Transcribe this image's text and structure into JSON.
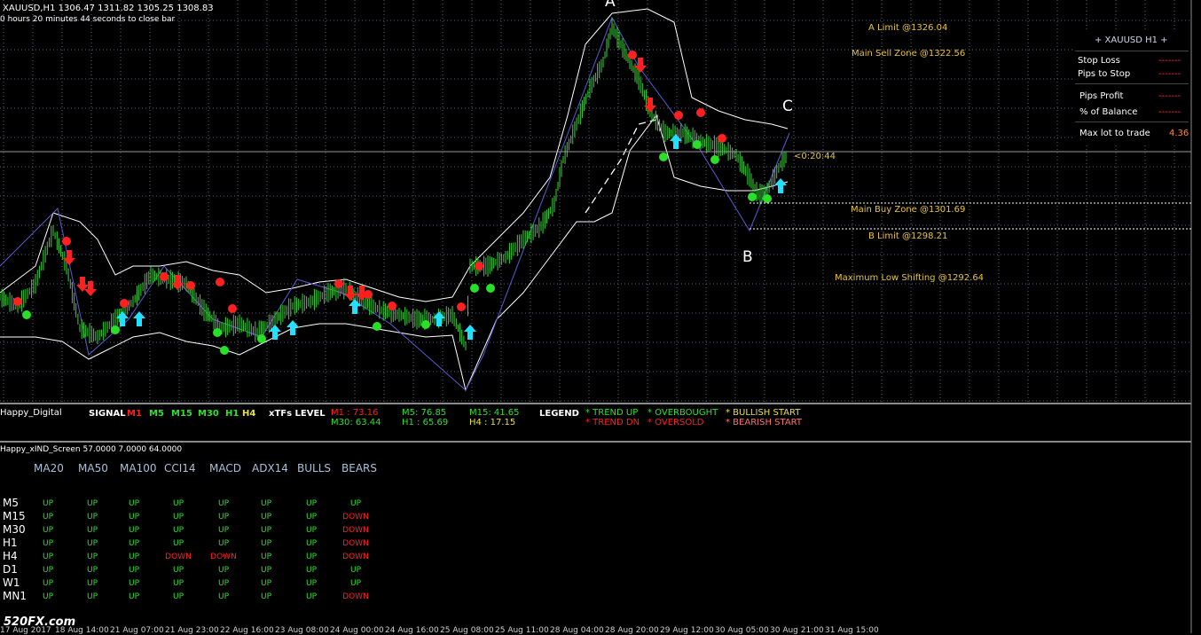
{
  "chart": {
    "symbol_line": "XAUUSD,H1  1306.47 1311.82 1305.25 1308.83",
    "timer_line": "0 hours 20 minutes 44 seconds to close bar",
    "countdown": "<0:20:44",
    "wave_labels": [
      "A",
      "B",
      "C"
    ],
    "zones": {
      "a_limit": "A Limit @1326.04",
      "main_sell": "Main Sell Zone @1322.56",
      "main_buy": "Main Buy Zone @1301.69",
      "b_limit": "B Limit @1298.21",
      "max_low": "Maximum Low Shifting @1292.64"
    },
    "time_axis": [
      "17 Aug 2017",
      "18 Aug 14:00",
      "21 Aug 07:00",
      "21 Aug 23:00",
      "22 Aug 16:00",
      "23 Aug 08:00",
      "24 Aug 00:00",
      "24 Aug 16:00",
      "25 Aug 08:00",
      "25 Aug 11:00",
      "28 Aug 04:00",
      "28 Aug 20:00",
      "29 Aug 12:00",
      "30 Aug 05:00",
      "30 Aug 21:00",
      "31 Aug 15:00"
    ],
    "watermark": "520FX.com"
  },
  "panel": {
    "title": "+  XAUUSD  H1  +",
    "rows": [
      {
        "label": "Stop Loss",
        "value": "-------"
      },
      {
        "label": "Pips to Stop",
        "value": "-------"
      },
      {
        "label": "Pips Profit",
        "value": "-------"
      },
      {
        "label": "% of Balance",
        "value": "-------"
      },
      {
        "label": "Max lot to trade",
        "value": "4.36"
      }
    ]
  },
  "signal_bar": {
    "name": "Happy_Digital",
    "signal_label": "SIGNAL",
    "tfs": [
      {
        "tf": "M1",
        "color": "#ff2020"
      },
      {
        "tf": "M5",
        "color": "#2fe02f"
      },
      {
        "tf": "M15",
        "color": "#2fe02f"
      },
      {
        "tf": "M30",
        "color": "#2fe02f"
      },
      {
        "tf": "H1",
        "color": "#2fe02f"
      },
      {
        "tf": "H4",
        "color": "#e8e040"
      }
    ],
    "xtfs_label": "xTFs LEVEL",
    "levels_row1": [
      {
        "text": "M1 : 73.16",
        "color": "#ff2020"
      },
      {
        "text": "M5: 76.85",
        "color": "#2fe02f"
      },
      {
        "text": "M15: 41.65",
        "color": "#2fe02f"
      }
    ],
    "levels_row2": [
      {
        "text": "M30: 63.44",
        "color": "#2fe02f"
      },
      {
        "text": "H1 : 65.69",
        "color": "#2fe02f"
      },
      {
        "text": "H4 : 17.15",
        "color": "#e8e040"
      }
    ],
    "legend_label": "LEGEND",
    "legend": {
      "trend_up": "* TREND UP",
      "trend_dn": "* TREND DN",
      "overbought": "* OVERBOUGHT",
      "oversold": "* OVERSOLD",
      "bullish": "* BULLISH START",
      "bearish": "* BEARISH START"
    }
  },
  "screen": {
    "title": "Happy_xIND_Screen 57.0000 7.0000 64.0000",
    "headers": [
      "MA20",
      "MA50",
      "MA100",
      "CCI14",
      "MACD",
      "ADX14",
      "BULLS",
      "BEARS"
    ],
    "rows": [
      {
        "tf": "M5",
        "vals": [
          "UP",
          "UP",
          "UP",
          "UP",
          "UP",
          "UP",
          "UP",
          "UP"
        ]
      },
      {
        "tf": "M15",
        "vals": [
          "UP",
          "UP",
          "UP",
          "UP",
          "UP",
          "UP",
          "UP",
          "DOWN"
        ]
      },
      {
        "tf": "M30",
        "vals": [
          "UP",
          "UP",
          "UP",
          "UP",
          "UP",
          "UP",
          "UP",
          "DOWN"
        ]
      },
      {
        "tf": "H1",
        "vals": [
          "UP",
          "UP",
          "UP",
          "UP",
          "UP",
          "UP",
          "UP",
          "DOWN"
        ]
      },
      {
        "tf": "H4",
        "vals": [
          "UP",
          "UP",
          "UP",
          "DOWN",
          "DOWN",
          "UP",
          "UP",
          "DOWN"
        ]
      },
      {
        "tf": "D1",
        "vals": [
          "UP",
          "UP",
          "UP",
          "UP",
          "UP",
          "UP",
          "UP",
          "UP"
        ]
      },
      {
        "tf": "W1",
        "vals": [
          "UP",
          "UP",
          "UP",
          "UP",
          "UP",
          "UP",
          "UP",
          "UP"
        ]
      },
      {
        "tf": "MN1",
        "vals": [
          "UP",
          "UP",
          "UP",
          "UP",
          "UP",
          "UP",
          "UP",
          "DOWN"
        ]
      }
    ]
  },
  "colors": {
    "grid": "#5a6470",
    "candle": "#36d636",
    "bands": "#ffffff",
    "zone_text": "#e8c53a",
    "buy_arrow": "#22e0ff",
    "sell_arrow": "#ff2020"
  }
}
